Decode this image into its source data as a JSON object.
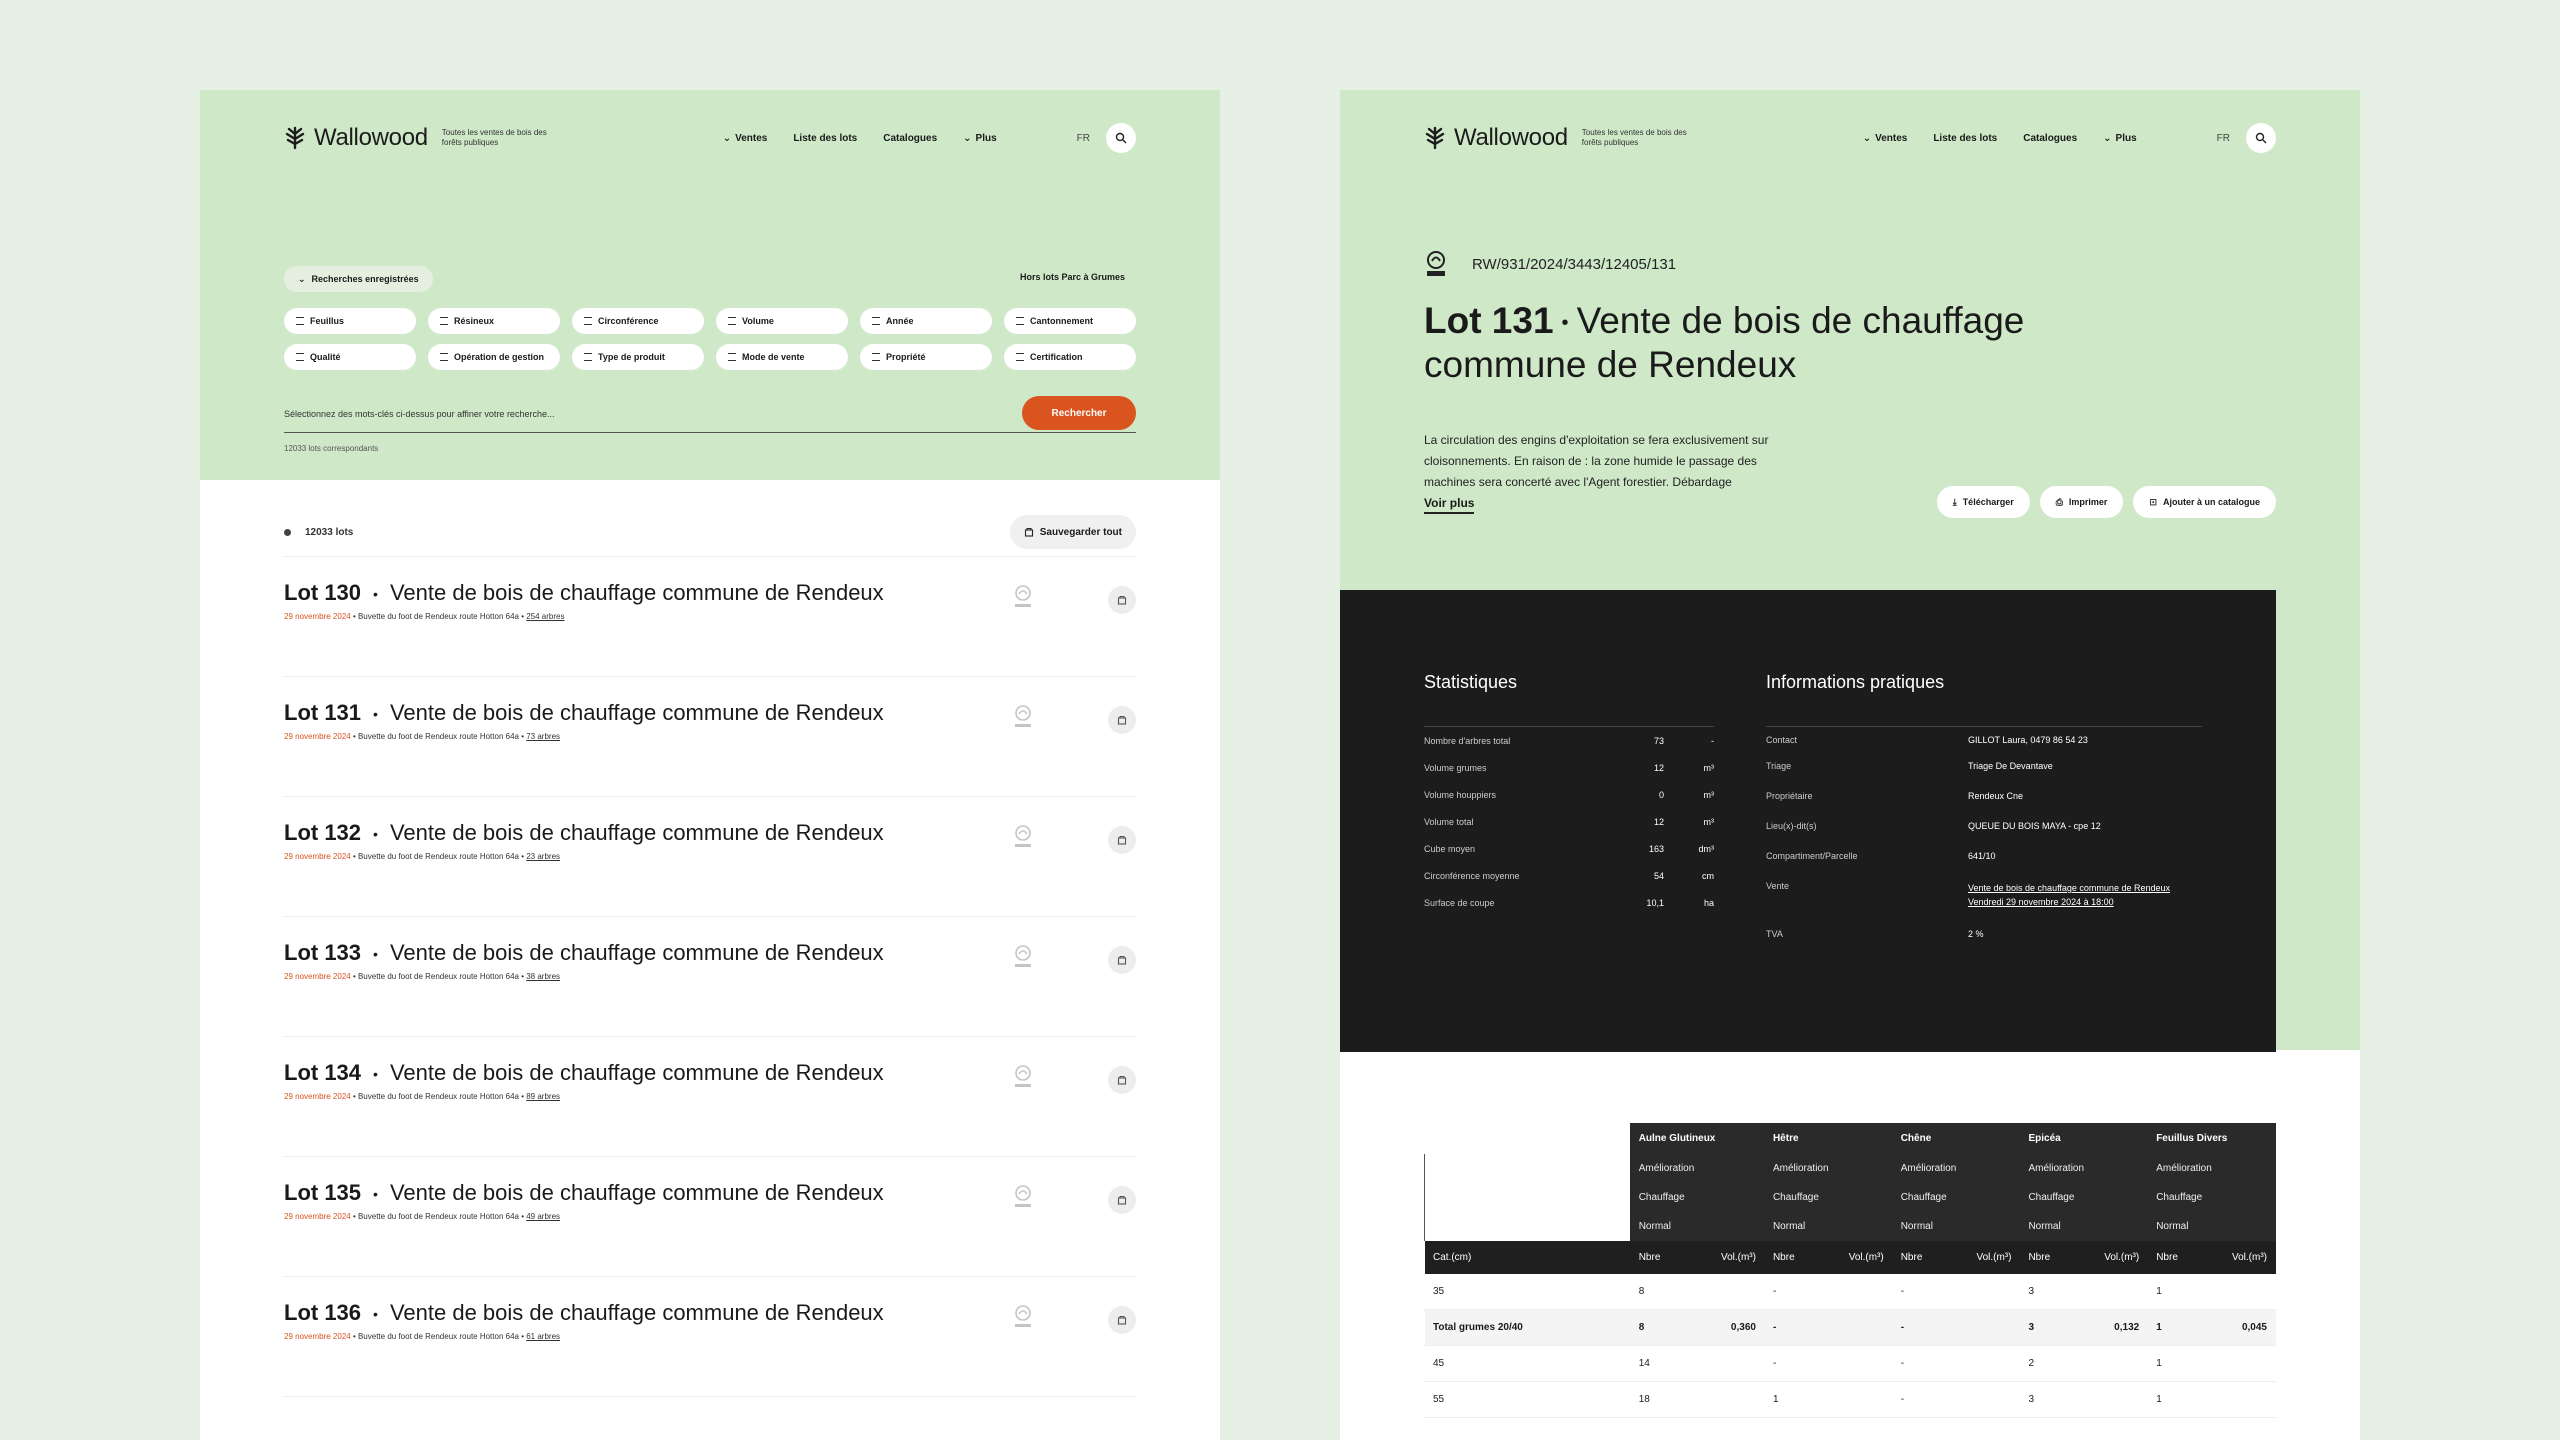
{
  "brand": {
    "name": "Wallowood",
    "tagline": "Toutes les ventes de bois des forêts publiques"
  },
  "nav": [
    "Ventes",
    "Liste des lots",
    "Catalogues",
    "Plus"
  ],
  "lang": "FR",
  "list_page": {
    "saved_searches": "Recherches enregistrées",
    "hors_lots": "Hors lots Parc à Grumes",
    "filters": [
      "Feuillus",
      "Résineux",
      "Circonférence",
      "Volume",
      "Année",
      "Cantonnement",
      "Qualité",
      "Opération de gestion",
      "Type de produit",
      "Mode de vente",
      "Propriété",
      "Certification"
    ],
    "search_placeholder": "Sélectionnez des mots-clés ci-dessus pour affiner votre recherche...",
    "search_button": "Rechercher",
    "results_small": "12033 lots correspondants",
    "total": "12033 lots",
    "save_all": "Sauvegarder tout",
    "lots": [
      {
        "num": "Lot 130",
        "title": "Vente de bois de chauffage commune de Rendeux",
        "date": "29 novembre 2024",
        "place": "Buvette du foot de Rendeux route Hotton 64a",
        "trees": "254 arbres"
      },
      {
        "num": "Lot 131",
        "title": "Vente de bois de chauffage commune de Rendeux",
        "date": "29 novembre 2024",
        "place": "Buvette du foot de Rendeux route Hotton 64a",
        "trees": "73 arbres"
      },
      {
        "num": "Lot 132",
        "title": "Vente de bois de chauffage commune de Rendeux",
        "date": "29 novembre 2024",
        "place": "Buvette du foot de Rendeux route Hotton 64a",
        "trees": "23 arbres"
      },
      {
        "num": "Lot 133",
        "title": "Vente de bois de chauffage commune de Rendeux",
        "date": "29 novembre 2024",
        "place": "Buvette du foot de Rendeux route Hotton 64a",
        "trees": "38 arbres"
      },
      {
        "num": "Lot 134",
        "title": "Vente de bois de chauffage commune de Rendeux",
        "date": "29 novembre 2024",
        "place": "Buvette du foot de Rendeux route Hotton 64a",
        "trees": "89 arbres"
      },
      {
        "num": "Lot 135",
        "title": "Vente de bois de chauffage commune de Rendeux",
        "date": "29 novembre 2024",
        "place": "Buvette du foot de Rendeux route Hotton 64a",
        "trees": "49 arbres"
      },
      {
        "num": "Lot 136",
        "title": "Vente de bois de chauffage commune de Rendeux",
        "date": "29 novembre 2024",
        "place": "Buvette du foot de Rendeux route Hotton 64a",
        "trees": "61 arbres"
      }
    ]
  },
  "detail_page": {
    "ref": "RW/931/2024/3443/12405/131",
    "lot": "Lot 131",
    "title": "Vente de bois de chauffage commune de Rendeux",
    "description": "La circulation des engins d'exploitation se fera exclusivement sur cloisonnements. En raison de : la zone humide le passage des machines sera concerté avec l'Agent forestier. Débardage",
    "more": "Voir plus",
    "actions": [
      "Télécharger",
      "Imprimer",
      "Ajouter à un catalogue"
    ],
    "stats_title": "Statistiques",
    "stats": [
      {
        "label": "Nombre d'arbres total",
        "value": "73",
        "unit": "-"
      },
      {
        "label": "Volume grumes",
        "value": "12",
        "unit": "m³"
      },
      {
        "label": "Volume houppiers",
        "value": "0",
        "unit": "m³"
      },
      {
        "label": "Volume total",
        "value": "12",
        "unit": "m³"
      },
      {
        "label": "Cube moyen",
        "value": "163",
        "unit": "dm³"
      },
      {
        "label": "Circonférence moyenne",
        "value": "54",
        "unit": "cm"
      },
      {
        "label": "Surface de coupe",
        "value": "10,1",
        "unit": "ha"
      }
    ],
    "info_title": "Informations pratiques",
    "info": [
      {
        "label": "Contact",
        "value": "GILLOT Laura, 0479 86 54 23"
      },
      {
        "label": "Triage",
        "value": "Triage De Devantave"
      },
      {
        "label": "Propriétaire",
        "value": "Rendeux Cne"
      },
      {
        "label": "Lieu(x)-dit(s)",
        "value": "QUEUE DU BOIS MAYA - cpe 12"
      },
      {
        "label": "Compartiment/Parcelle",
        "value": "641/10"
      },
      {
        "label": "Vente",
        "value": "Vente de bois de chauffage commune de Rendeux",
        "value2": "Vendredi 29 novembre 2024 à 18:00"
      },
      {
        "label": "TVA",
        "value": "2 %"
      }
    ],
    "species": [
      "Aulne Glutineux",
      "Hêtre",
      "Chêne",
      "Epicéa",
      "Feuillus Divers"
    ],
    "quality_rows": [
      "Amélioration",
      "Chauffage",
      "Normal"
    ],
    "col_cat": "Cat.(cm)",
    "col_nbre": "Nbre",
    "col_vol": "Vol.(m³)",
    "rows": [
      {
        "cat": "35",
        "cells": [
          "8",
          "",
          "-",
          "",
          "-",
          "",
          "3",
          "",
          "1",
          ""
        ]
      },
      {
        "cat": "Total grumes 20/40",
        "total": true,
        "cells": [
          "8",
          "0,360",
          "-",
          "",
          "-",
          "",
          "3",
          "0,132",
          "1",
          "0,045"
        ]
      },
      {
        "cat": "45",
        "cells": [
          "14",
          "",
          "-",
          "",
          "-",
          "",
          "2",
          "",
          "1",
          ""
        ]
      },
      {
        "cat": "55",
        "cells": [
          "18",
          "",
          "1",
          "",
          "-",
          "",
          "3",
          "",
          "1",
          ""
        ]
      }
    ]
  }
}
